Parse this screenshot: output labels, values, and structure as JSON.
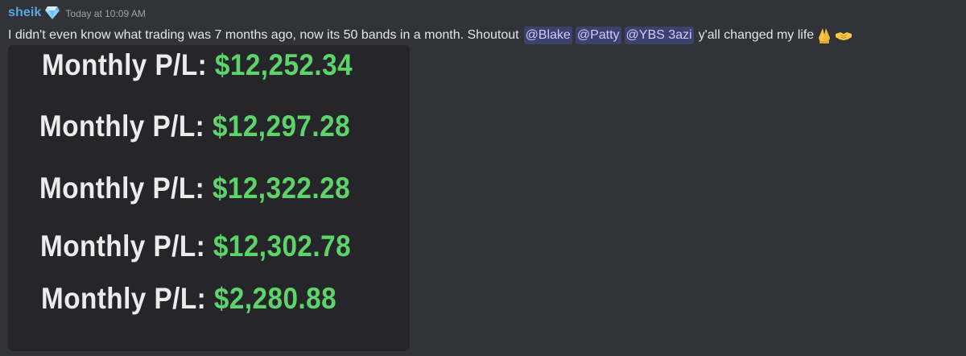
{
  "message": {
    "author": "sheik",
    "badge_icon": "diamond-icon",
    "timestamp": "Today at 10:09 AM",
    "text_before": "I didn't even know what trading was 7 months ago, now its 50 bands in a month. Shoutout",
    "mentions": [
      "@Blake",
      "@Patty",
      "@YBS 3azi"
    ],
    "text_after": "y'all changed my life",
    "emojis": [
      "folded-hands-icon",
      "handshake-icon"
    ]
  },
  "attachment": {
    "rows": [
      {
        "label": "Monthly P/L:",
        "value": "$12,252.34"
      },
      {
        "label": "Monthly P/L:",
        "value": "$12,297.28"
      },
      {
        "label": "Monthly P/L:",
        "value": "$12,322.28"
      },
      {
        "label": "Monthly P/L:",
        "value": "$12,302.78"
      },
      {
        "label": "Monthly P/L:",
        "value": "$2,280.88"
      }
    ]
  },
  "colors": {
    "background": "#313338",
    "username": "#5aa7e6",
    "mention_bg": "#3c4270",
    "profit_green": "#5dd46a",
    "attachment_bg": "#26262a"
  }
}
